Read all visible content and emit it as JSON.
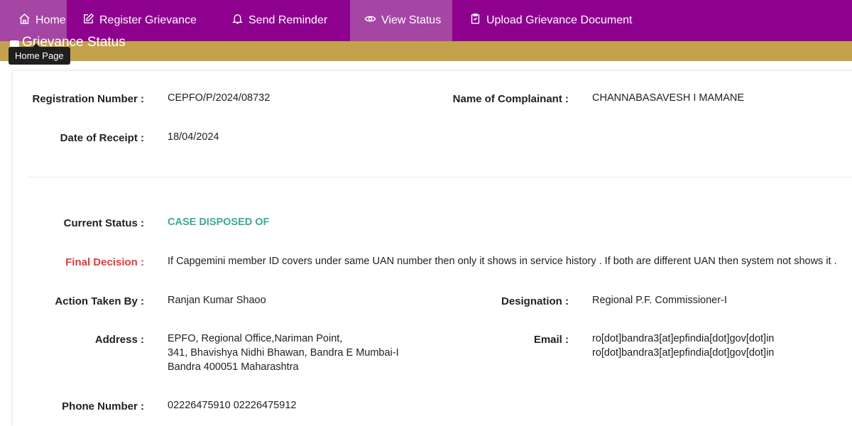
{
  "nav": {
    "items": [
      {
        "label": "Home",
        "icon": "home-icon"
      },
      {
        "label": "Register Grievance",
        "icon": "edit-icon"
      },
      {
        "label": "Send Reminder",
        "icon": "bell-icon"
      },
      {
        "label": "View Status",
        "icon": "eye-icon"
      },
      {
        "label": "Upload Grievance Document",
        "icon": "document-icon"
      }
    ],
    "colors": {
      "background": "#8e008e",
      "active": "#a546a5"
    }
  },
  "section": {
    "title": "Grievance Status",
    "bar_color": "#c4a24c"
  },
  "tooltip": {
    "text": "Home Page"
  },
  "details": {
    "registration_label": "Registration Number :",
    "registration_value": "CEPFO/P/2024/08732",
    "complainant_label": "Name of Complainant :",
    "complainant_value": "CHANNABASAVESH I MAMANE",
    "receipt_label": "Date of Receipt :",
    "receipt_value": "18/04/2024",
    "status_label": "Current Status :",
    "status_value": "CASE DISPOSED OF",
    "final_label": "Final Decision :",
    "final_value": "If Capgemini member ID covers under same UAN number then only it shows in service history . If both are different UAN then system not shows it .",
    "action_label": "Action Taken By :",
    "action_value": "Ranjan Kumar Shaoo",
    "designation_label": "Designation :",
    "designation_value": "Regional P.F. Commissioner-I",
    "address_label": "Address :",
    "address_lines": [
      "EPFO, Regional Office,Nariman Point,",
      "341, Bhavishya Nidhi Bhawan, Bandra E Mumbai-I",
      "Bandra 400051 Maharashtra"
    ],
    "email_label": "Email :",
    "email_lines": [
      "ro[dot]bandra3[at]epfindia[dot]gov[dot]in",
      "ro[dot]bandra3[at]epfindia[dot]gov[dot]in"
    ],
    "phone_label": "Phone Number :",
    "phone_value": "02226475910 02226475912"
  },
  "colors": {
    "status": "#3aa99b",
    "final_decision_label": "#e23a3a"
  }
}
